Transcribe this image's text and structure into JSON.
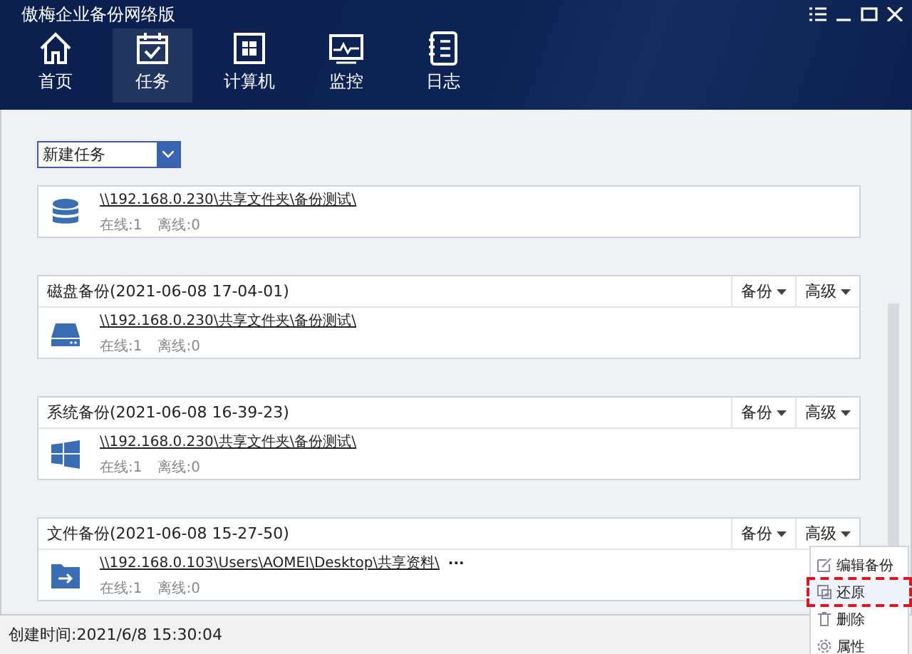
{
  "window": {
    "title": "傲梅企业备份网络版"
  },
  "nav": [
    {
      "label": "首页",
      "selected": false
    },
    {
      "label": "任务",
      "selected": true
    },
    {
      "label": "计算机",
      "selected": false
    },
    {
      "label": "监控",
      "selected": false
    },
    {
      "label": "日志",
      "selected": false
    }
  ],
  "new_task": {
    "value": "新建任务"
  },
  "tasks": [
    {
      "kind": "database",
      "path": "\\\\192.168.0.230\\共享文件夹\\备份测试\\",
      "online": "在线:1",
      "offline": "离线:0"
    },
    {
      "kind": "disk",
      "title": "磁盘备份(2021-06-08 17-04-01)",
      "backup": "备份",
      "advanced": "高级",
      "path": "\\\\192.168.0.230\\共享文件夹\\备份测试\\",
      "online": "在线:1",
      "offline": "离线:0"
    },
    {
      "kind": "windows",
      "title": "系统备份(2021-06-08 16-39-23)",
      "backup": "备份",
      "advanced": "高级",
      "path": "\\\\192.168.0.230\\共享文件夹\\备份测试\\",
      "online": "在线:1",
      "offline": "离线:0"
    },
    {
      "kind": "folder",
      "title": "文件备份(2021-06-08 15-27-50)",
      "backup": "备份",
      "advanced": "高级",
      "path": "\\\\192.168.0.103\\Users\\AOMEI\\Desktop\\共享资料\\",
      "more": "...",
      "online": "在线:1",
      "offline": "离线:0"
    }
  ],
  "menu": [
    {
      "label": "编辑备份",
      "selected": false
    },
    {
      "label": "还原",
      "selected": true
    },
    {
      "label": "删除",
      "selected": false
    },
    {
      "label": "属性",
      "selected": false
    }
  ],
  "status_bar": {
    "text": "创建时间:2021/6/8 15:30:04"
  }
}
